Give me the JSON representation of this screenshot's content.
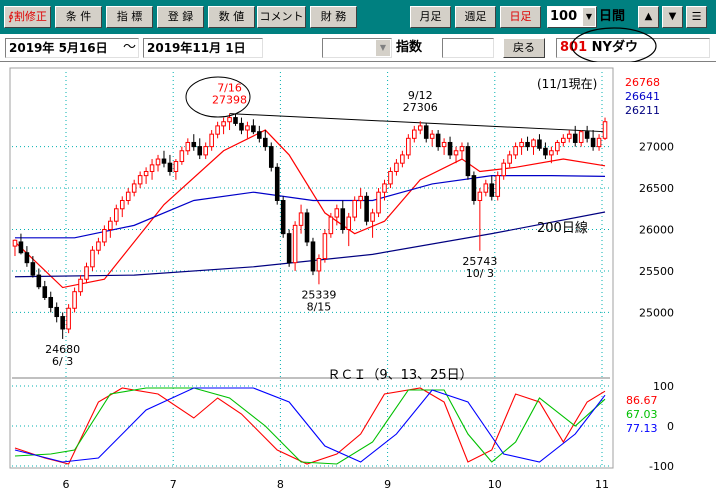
{
  "toolbar": {
    "buttons": [
      "∮割修正",
      "条 件",
      "指 標",
      "登 録",
      "数 値",
      "コメント",
      "財 務"
    ],
    "freq_buttons": [
      "月足",
      "週足",
      "日足"
    ],
    "count_value": "100",
    "count_unit": "日間",
    "up_arrow": "▲",
    "down_arrow": "▼",
    "menu": "☰"
  },
  "range": {
    "start": "2019年 5月16日",
    "tilde": "～",
    "end": "2019年11月 1日",
    "index_label": "指数",
    "back_label": "戻る",
    "code": "801",
    "name": "NYダウ"
  },
  "colors": {
    "price_up": "#ff0000",
    "price_down": "#000000",
    "ma_short": "#ff0000",
    "ma_mid": "#0000c8",
    "ma_long": "#000080",
    "rci_short": "#ff0000",
    "rci_mid": "#00c000",
    "rci_long": "#0000ff"
  },
  "chart_data": {
    "type": "line",
    "subtype": "candlestick",
    "note": "(11/1現在)",
    "x_months": [
      "6",
      "7",
      "8",
      "9",
      "10",
      "11"
    ],
    "ylim": [
      24450,
      27900
    ],
    "y_ticks": [
      25000,
      25500,
      26000,
      26500,
      27000
    ],
    "candles": [
      [
        25800,
        25880,
        25680,
        25870
      ],
      [
        25850,
        25950,
        25700,
        25720
      ],
      [
        25720,
        25800,
        25550,
        25600
      ],
      [
        25600,
        25680,
        25420,
        25450
      ],
      [
        25450,
        25530,
        25280,
        25310
      ],
      [
        25310,
        25380,
        25150,
        25180
      ],
      [
        25180,
        25250,
        25000,
        25060
      ],
      [
        25060,
        25120,
        24880,
        24950
      ],
      [
        24950,
        25000,
        24680,
        24800
      ],
      [
        24800,
        25100,
        24750,
        25050
      ],
      [
        25050,
        25300,
        25000,
        25250
      ],
      [
        25250,
        25450,
        25200,
        25400
      ],
      [
        25400,
        25600,
        25350,
        25550
      ],
      [
        25550,
        25800,
        25500,
        25750
      ],
      [
        25750,
        25900,
        25700,
        25850
      ],
      [
        25850,
        26050,
        25800,
        26000
      ],
      [
        26000,
        26150,
        25900,
        26100
      ],
      [
        26100,
        26300,
        26050,
        26250
      ],
      [
        26250,
        26400,
        26150,
        26350
      ],
      [
        26350,
        26500,
        26300,
        26450
      ],
      [
        26450,
        26600,
        26400,
        26550
      ],
      [
        26550,
        26700,
        26500,
        26650
      ],
      [
        26650,
        26750,
        26550,
        26700
      ],
      [
        26700,
        26850,
        26600,
        26780
      ],
      [
        26780,
        26900,
        26700,
        26850
      ],
      [
        26850,
        26950,
        26750,
        26800
      ],
      [
        26800,
        26900,
        26650,
        26700
      ],
      [
        26700,
        26850,
        26600,
        26820
      ],
      [
        26820,
        27000,
        26780,
        26950
      ],
      [
        26950,
        27100,
        26900,
        27050
      ],
      [
        27050,
        27150,
        26950,
        27000
      ],
      [
        27000,
        27100,
        26850,
        26900
      ],
      [
        26900,
        27050,
        26850,
        27000
      ],
      [
        27000,
        27200,
        26950,
        27150
      ],
      [
        27150,
        27300,
        27100,
        27250
      ],
      [
        27250,
        27350,
        27150,
        27300
      ],
      [
        27300,
        27398,
        27200,
        27350
      ],
      [
        27350,
        27390,
        27250,
        27280
      ],
      [
        27280,
        27350,
        27150,
        27200
      ],
      [
        27200,
        27300,
        27100,
        27250
      ],
      [
        27250,
        27330,
        27150,
        27180
      ],
      [
        27180,
        27250,
        27050,
        27100
      ],
      [
        27100,
        27200,
        26950,
        27000
      ],
      [
        27000,
        27050,
        26700,
        26750
      ],
      [
        26750,
        26800,
        26300,
        26350
      ],
      [
        26350,
        26400,
        25900,
        25950
      ],
      [
        25950,
        26000,
        25550,
        25600
      ],
      [
        25600,
        26100,
        25500,
        26050
      ],
      [
        26050,
        26300,
        25950,
        26200
      ],
      [
        26200,
        26250,
        25800,
        25850
      ],
      [
        25850,
        25900,
        25450,
        25500
      ],
      [
        25500,
        25700,
        25339,
        25650
      ],
      [
        25650,
        26000,
        25600,
        25950
      ],
      [
        25950,
        26200,
        25900,
        26150
      ],
      [
        26150,
        26300,
        26050,
        26250
      ],
      [
        26250,
        26350,
        25950,
        26000
      ],
      [
        26000,
        26200,
        25800,
        26150
      ],
      [
        26150,
        26400,
        26100,
        26350
      ],
      [
        26350,
        26500,
        26250,
        26400
      ],
      [
        26400,
        26450,
        26050,
        26100
      ],
      [
        26100,
        26250,
        25900,
        26200
      ],
      [
        26200,
        26500,
        26150,
        26450
      ],
      [
        26450,
        26600,
        26350,
        26550
      ],
      [
        26550,
        26750,
        26500,
        26700
      ],
      [
        26700,
        26850,
        26650,
        26800
      ],
      [
        26800,
        26950,
        26750,
        26900
      ],
      [
        26900,
        27150,
        26850,
        27100
      ],
      [
        27100,
        27250,
        27050,
        27200
      ],
      [
        27200,
        27306,
        27150,
        27250
      ],
      [
        27250,
        27280,
        27050,
        27100
      ],
      [
        27100,
        27200,
        27000,
        27150
      ],
      [
        27150,
        27200,
        26950,
        27000
      ],
      [
        27000,
        27100,
        26900,
        27050
      ],
      [
        27050,
        27120,
        26850,
        26900
      ],
      [
        26900,
        27000,
        26800,
        26950
      ],
      [
        26950,
        27050,
        26850,
        27000
      ],
      [
        27000,
        27050,
        26600,
        26650
      ],
      [
        26650,
        26700,
        26300,
        26350
      ],
      [
        26350,
        26500,
        25743,
        26450
      ],
      [
        26450,
        26600,
        26400,
        26550
      ],
      [
        26550,
        26650,
        26350,
        26400
      ],
      [
        26400,
        26700,
        26350,
        26650
      ],
      [
        26650,
        26850,
        26600,
        26800
      ],
      [
        26800,
        26950,
        26750,
        26900
      ],
      [
        26900,
        27050,
        26850,
        27000
      ],
      [
        27000,
        27100,
        26900,
        27050
      ],
      [
        27050,
        27120,
        26950,
        27000
      ],
      [
        27000,
        27100,
        26900,
        27080
      ],
      [
        27080,
        27150,
        26950,
        26980
      ],
      [
        26980,
        27050,
        26850,
        26900
      ],
      [
        26900,
        27000,
        26800,
        26950
      ],
      [
        26950,
        27080,
        26900,
        27050
      ],
      [
        27050,
        27150,
        27000,
        27100
      ],
      [
        27100,
        27200,
        27050,
        27150
      ],
      [
        27150,
        27250,
        27000,
        27050
      ],
      [
        27050,
        27200,
        27000,
        27180
      ],
      [
        27180,
        27250,
        27050,
        27100
      ],
      [
        27100,
        27200,
        26950,
        27000
      ],
      [
        27000,
        27150,
        26950,
        27100
      ],
      [
        27100,
        27350,
        27080,
        27300
      ]
    ],
    "ma_values": [
      {
        "name": "MA short",
        "color_key": "ma_short",
        "last": 26768,
        "values": [
          [
            0,
            25850
          ],
          [
            8,
            25300
          ],
          [
            15,
            25400
          ],
          [
            25,
            26300
          ],
          [
            35,
            26950
          ],
          [
            42,
            27200
          ],
          [
            46,
            26900
          ],
          [
            52,
            26200
          ],
          [
            57,
            25950
          ],
          [
            62,
            26100
          ],
          [
            68,
            26600
          ],
          [
            75,
            26850
          ],
          [
            78,
            26700
          ],
          [
            84,
            26750
          ],
          [
            92,
            26850
          ],
          [
            100,
            26768
          ]
        ]
      },
      {
        "name": "MA mid",
        "color_key": "ma_mid",
        "last": 26641,
        "values": [
          [
            0,
            25900
          ],
          [
            10,
            25900
          ],
          [
            20,
            26050
          ],
          [
            30,
            26350
          ],
          [
            40,
            26450
          ],
          [
            50,
            26350
          ],
          [
            60,
            26350
          ],
          [
            70,
            26550
          ],
          [
            80,
            26650
          ],
          [
            90,
            26650
          ],
          [
            100,
            26641
          ]
        ]
      },
      {
        "name": "MA long",
        "color_key": "ma_long",
        "last": 26211,
        "values": [
          [
            0,
            25430
          ],
          [
            20,
            25450
          ],
          [
            40,
            25550
          ],
          [
            60,
            25700
          ],
          [
            80,
            25950
          ],
          [
            100,
            26211
          ]
        ]
      }
    ],
    "annotations": [
      {
        "text": "7/16",
        "text2": "27398",
        "i": 36,
        "price": 27398,
        "color": "#ff0000",
        "place": "above"
      },
      {
        "text": "9/12",
        "text2": "27306",
        "i": 68,
        "price": 27306,
        "color": "#000000",
        "place": "above"
      },
      {
        "text": "24680",
        "text2": "6/ 3",
        "i": 8,
        "price": 24680,
        "color": "#000000",
        "place": "below"
      },
      {
        "text": "25339",
        "text2": "8/15",
        "i": 51,
        "price": 25339,
        "color": "#000000",
        "place": "below"
      },
      {
        "text": "25743",
        "text2": "10/ 3",
        "i": 78,
        "price": 25743,
        "color": "#000000",
        "place": "below"
      }
    ],
    "ma_label": "200日線",
    "legend_values": [
      "26768",
      "26641",
      "26211"
    ],
    "rci": {
      "title": "ＲＣＩ（9、13、25日）",
      "ylim": [
        -100,
        100
      ],
      "y_ticks": [
        "100",
        "0",
        "-100"
      ],
      "series": [
        {
          "name": "RCI 9",
          "color_key": "rci_short",
          "last": "86.67",
          "values": [
            [
              0,
              -55
            ],
            [
              5,
              -80
            ],
            [
              9,
              -95
            ],
            [
              14,
              60
            ],
            [
              18,
              95
            ],
            [
              24,
              80
            ],
            [
              30,
              20
            ],
            [
              34,
              70
            ],
            [
              38,
              30
            ],
            [
              44,
              -60
            ],
            [
              49,
              -95
            ],
            [
              54,
              -70
            ],
            [
              58,
              -20
            ],
            [
              62,
              80
            ],
            [
              68,
              95
            ],
            [
              72,
              60
            ],
            [
              76,
              -90
            ],
            [
              80,
              -60
            ],
            [
              84,
              80
            ],
            [
              88,
              60
            ],
            [
              92,
              -40
            ],
            [
              96,
              60
            ],
            [
              100,
              87
            ]
          ]
        },
        {
          "name": "RCI 13",
          "color_key": "rci_mid",
          "last": "67.03",
          "values": [
            [
              0,
              -75
            ],
            [
              6,
              -70
            ],
            [
              10,
              -60
            ],
            [
              16,
              80
            ],
            [
              22,
              95
            ],
            [
              30,
              95
            ],
            [
              36,
              70
            ],
            [
              42,
              0
            ],
            [
              48,
              -90
            ],
            [
              54,
              -95
            ],
            [
              60,
              -40
            ],
            [
              66,
              90
            ],
            [
              72,
              90
            ],
            [
              76,
              -20
            ],
            [
              80,
              -90
            ],
            [
              84,
              -40
            ],
            [
              88,
              70
            ],
            [
              94,
              0
            ],
            [
              100,
              67
            ]
          ]
        },
        {
          "name": "RCI 25",
          "color_key": "rci_long",
          "last": "77.13",
          "values": [
            [
              0,
              -60
            ],
            [
              8,
              -90
            ],
            [
              14,
              -80
            ],
            [
              22,
              40
            ],
            [
              30,
              95
            ],
            [
              40,
              95
            ],
            [
              46,
              60
            ],
            [
              52,
              -50
            ],
            [
              58,
              -90
            ],
            [
              64,
              -20
            ],
            [
              70,
              90
            ],
            [
              76,
              60
            ],
            [
              82,
              -70
            ],
            [
              88,
              -90
            ],
            [
              94,
              -20
            ],
            [
              100,
              77
            ]
          ]
        }
      ]
    }
  }
}
